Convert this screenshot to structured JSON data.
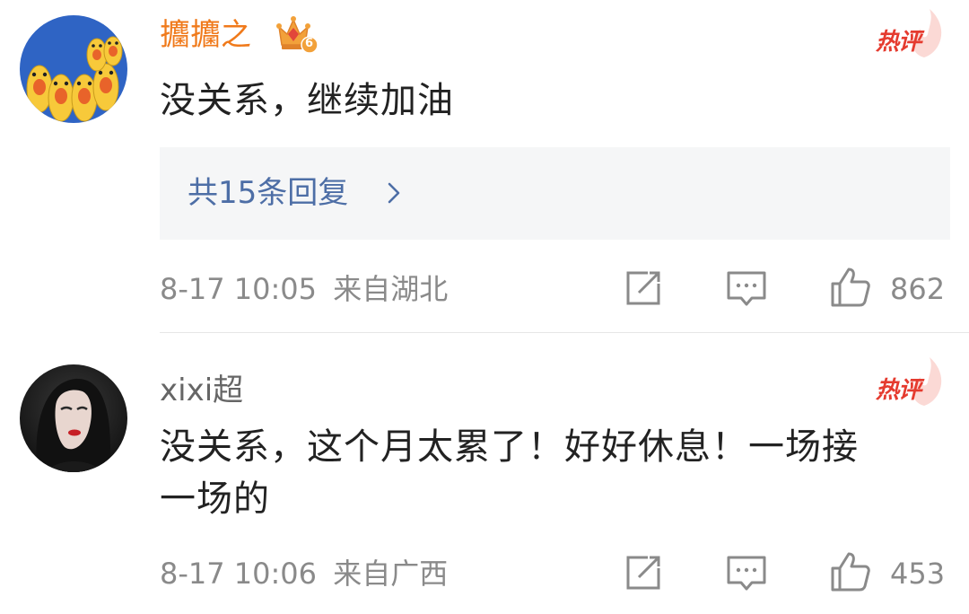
{
  "comments": [
    {
      "username": "攟攟之",
      "badge_icon": "crown-vip-badge-icon",
      "badge_level": "6",
      "hot_label": "热评",
      "text": "没关系，继续加油",
      "replies_label": "共15条回复",
      "timestamp": "8-17 10:05",
      "location": "来自湖北",
      "like_count": "862"
    },
    {
      "username": "xixi超",
      "hot_label": "热评",
      "text_line1": "没关系，这个月太累了！好好休息！一场接",
      "text_line2": "一场的",
      "timestamp": "8-17 10:06",
      "location": "来自广西",
      "like_count": "453"
    }
  ],
  "colors": {
    "vip_name": "#f07a1b",
    "hot_red": "#e53b2f",
    "reply_link": "#4d6ea6",
    "meta_gray": "#8a8a8a",
    "reply_bg": "#f5f6f7"
  }
}
